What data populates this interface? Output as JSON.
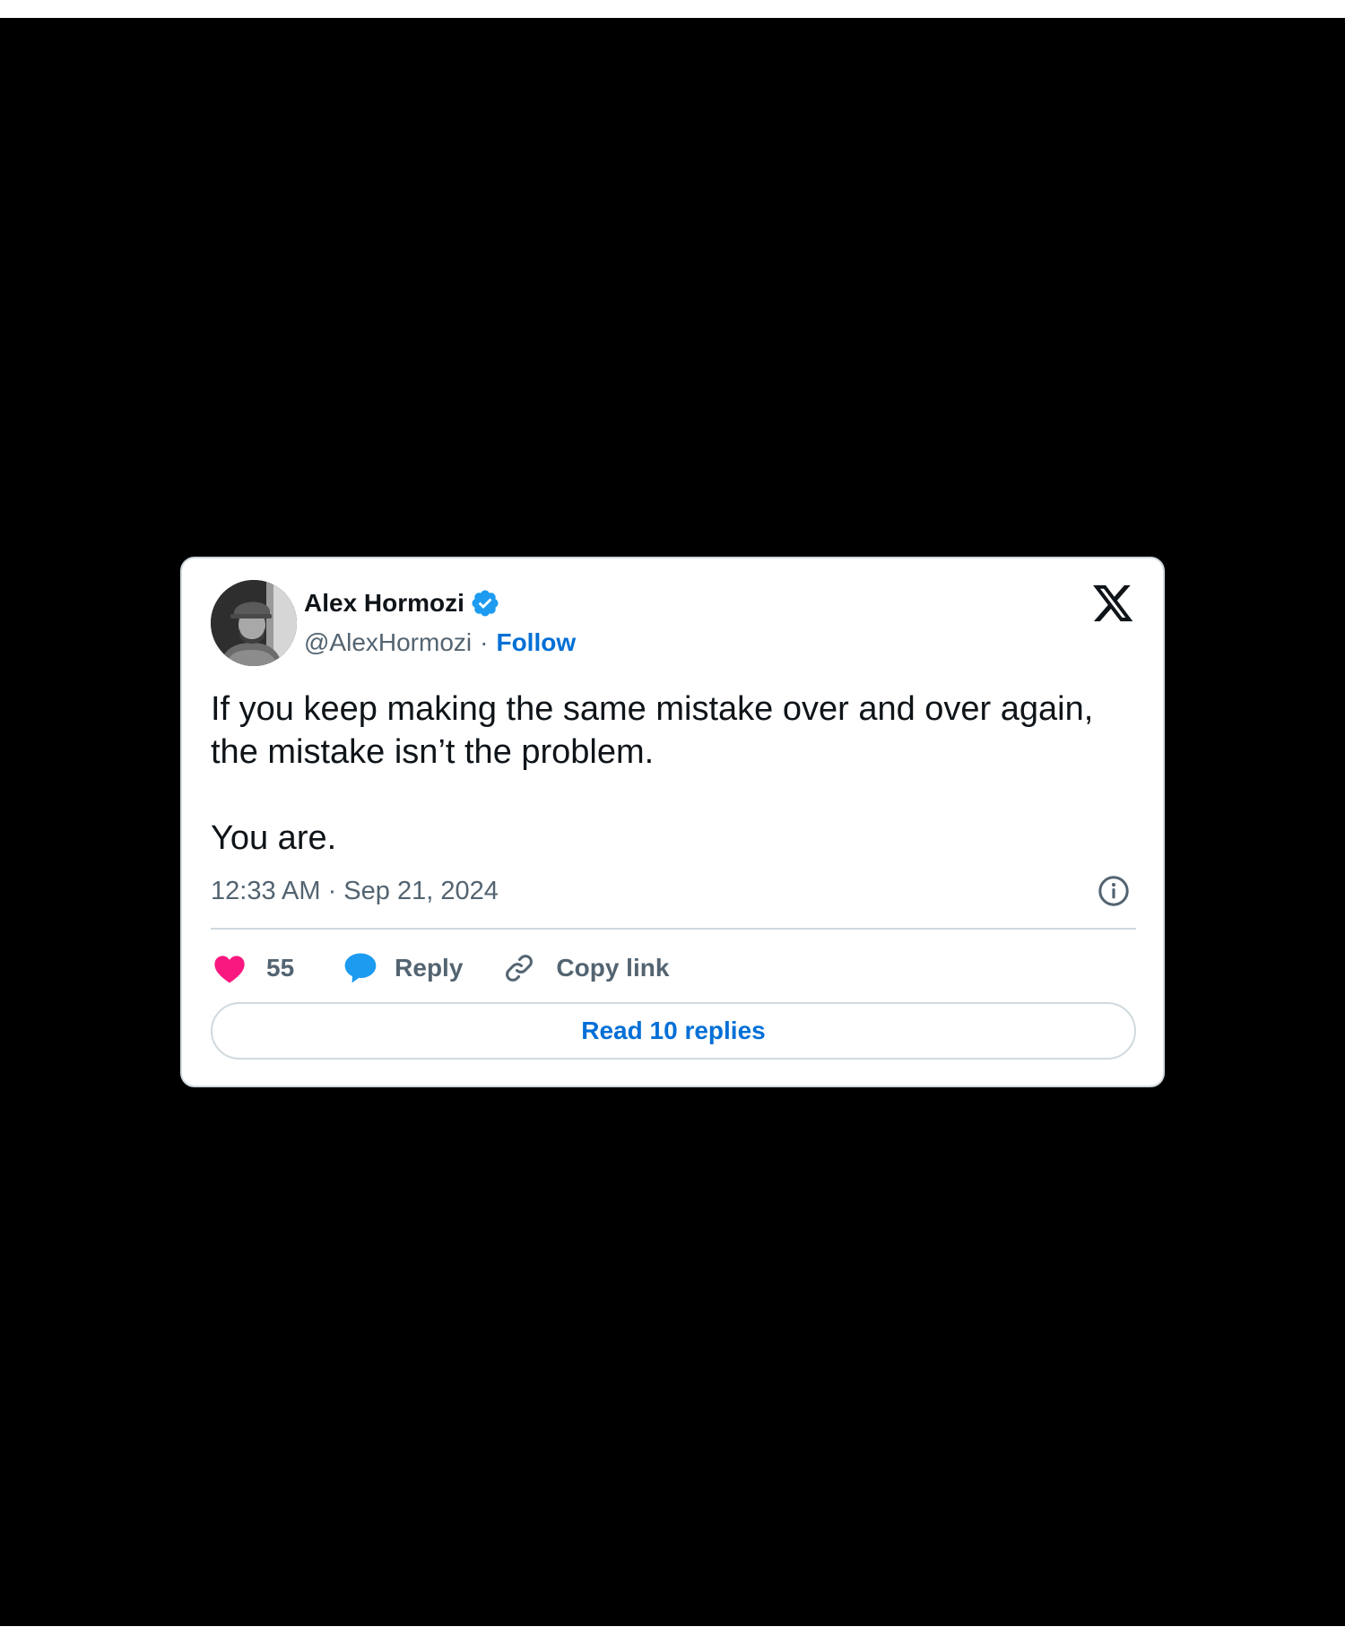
{
  "tweet": {
    "author": {
      "display_name": "Alex Hormozi",
      "handle": "@AlexHormozi",
      "separator": "·",
      "follow_label": "Follow",
      "verified": true,
      "avatar_icon": "profile-photo"
    },
    "text_lines": [
      "If you keep making the same mistake over and over again,",
      "the mistake isn’t the problem.",
      "You are."
    ],
    "timestamp": "12:33 AM · Sep 21, 2024",
    "actions": {
      "likes": "55",
      "reply_label": "Reply",
      "copy_link_label": "Copy link"
    },
    "read_replies_label": "Read 10 replies"
  },
  "icons": {
    "platform_logo": "x-logo-icon",
    "verified": "verified-badge-icon",
    "info": "info-icon",
    "like": "heart-icon",
    "reply": "speech-bubble-icon",
    "copy": "link-icon"
  },
  "colors": {
    "background": "#000000",
    "card": "#ffffff",
    "text": "#0f1419",
    "secondary_text": "#536471",
    "link": "#006fd6",
    "verified": "#1d9bf0",
    "heart": "#f91880",
    "reply_bubble": "#1d9bf0",
    "border": "#cfd9de"
  }
}
